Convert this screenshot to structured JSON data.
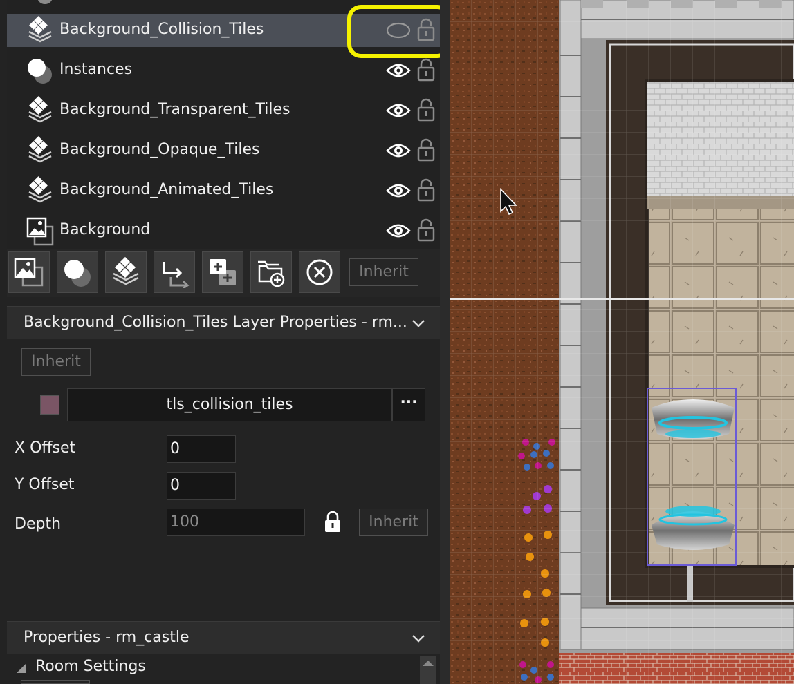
{
  "layers": [
    {
      "name": "Background_Collision_Tiles",
      "icon": "tile-layer-icon",
      "selected": true,
      "visible": false
    },
    {
      "name": "Instances",
      "icon": "instance-layer-icon",
      "selected": false,
      "visible": true
    },
    {
      "name": "Background_Transparent_Tiles",
      "icon": "tile-layer-icon",
      "selected": false,
      "visible": true
    },
    {
      "name": "Background_Opaque_Tiles",
      "icon": "tile-layer-icon",
      "selected": false,
      "visible": true
    },
    {
      "name": "Background_Animated_Tiles",
      "icon": "tile-layer-icon",
      "selected": false,
      "visible": true
    },
    {
      "name": "Background",
      "icon": "background-layer-icon",
      "selected": false,
      "visible": true
    }
  ],
  "toolbar": {
    "buttons": [
      "add-background-layer",
      "add-instance-layer",
      "add-tile-layer",
      "add-path-layer",
      "add-asset-layer",
      "add-folder",
      "delete-layer"
    ],
    "inherit_label": "Inherit"
  },
  "layer_properties": {
    "title": "Background_Collision_Tiles Layer Properties - rm...",
    "inherit_label": "Inherit",
    "tileset": "tls_collision_tiles",
    "tileset_more": "···",
    "swatch_color": "#7a5565",
    "x_offset_label": "X Offset",
    "x_offset": "0",
    "y_offset_label": "Y Offset",
    "y_offset": "0",
    "depth_label": "Depth",
    "depth": "100",
    "depth_inherit_label": "Inherit"
  },
  "room_properties": {
    "title": "Properties - rm_castle",
    "room_settings_label": "Room Settings"
  },
  "colors": {
    "highlight": "#f5f200",
    "selected_row": "#4b4f57",
    "panel_bg": "#232323"
  }
}
